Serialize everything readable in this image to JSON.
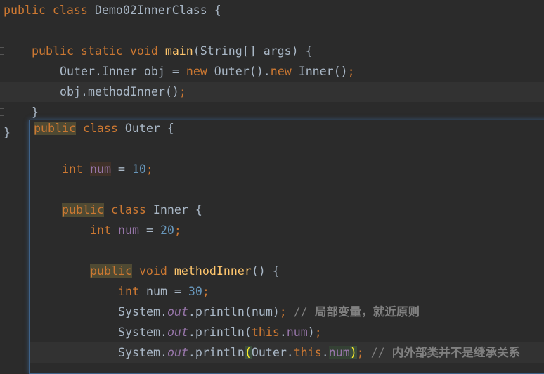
{
  "editor": {
    "current_line": 4,
    "lines": [
      {
        "indent": 0,
        "tokens": [
          [
            "k",
            "public class "
          ],
          [
            "t",
            "Demo02InnerClass {"
          ]
        ]
      },
      {
        "indent": 0,
        "tokens": []
      },
      {
        "indent": 1,
        "tokens": [
          [
            "k",
            "public static void "
          ],
          [
            "m",
            "main"
          ],
          [
            "t",
            "(String[] args) {"
          ]
        ]
      },
      {
        "indent": 2,
        "tokens": [
          [
            "t",
            "Outer.Inner obj = "
          ],
          [
            "k",
            "new "
          ],
          [
            "t",
            "Outer()."
          ],
          [
            "k",
            "new "
          ],
          [
            "t",
            "Inner()"
          ],
          [
            "k",
            ";"
          ]
        ]
      },
      {
        "indent": 2,
        "tokens": [
          [
            "t",
            "obj.methodInner()"
          ],
          [
            "k",
            ";"
          ]
        ]
      },
      {
        "indent": 1,
        "tokens": [
          [
            "t",
            "}"
          ]
        ]
      },
      {
        "indent": 0,
        "tokens": [
          [
            "t",
            "}"
          ]
        ]
      }
    ]
  },
  "popup": {
    "current_line": 11,
    "lines": [
      {
        "indent": 0,
        "tokens": [
          [
            "k hl-usage",
            "public"
          ],
          [
            "k",
            " class "
          ],
          [
            "t",
            "Outer {"
          ]
        ]
      },
      {
        "indent": 0,
        "tokens": []
      },
      {
        "indent": 1,
        "tokens": [
          [
            "k",
            "int "
          ],
          [
            "f hl-var",
            "num"
          ],
          [
            "t",
            " = "
          ],
          [
            "n",
            "10"
          ],
          [
            "k",
            ";"
          ]
        ]
      },
      {
        "indent": 0,
        "tokens": []
      },
      {
        "indent": 1,
        "tokens": [
          [
            "k hl-usage",
            "public"
          ],
          [
            "k",
            " class "
          ],
          [
            "t",
            "Inner {"
          ]
        ]
      },
      {
        "indent": 2,
        "tokens": [
          [
            "k",
            "int "
          ],
          [
            "f",
            "num"
          ],
          [
            "t",
            " = "
          ],
          [
            "n",
            "20"
          ],
          [
            "k",
            ";"
          ]
        ]
      },
      {
        "indent": 0,
        "tokens": []
      },
      {
        "indent": 2,
        "tokens": [
          [
            "k hl-usage",
            "public"
          ],
          [
            "k",
            " void "
          ],
          [
            "m",
            "methodInner"
          ],
          [
            "t",
            "() {"
          ]
        ]
      },
      {
        "indent": 3,
        "tokens": [
          [
            "k",
            "int "
          ],
          [
            "t",
            "num = "
          ],
          [
            "n",
            "30"
          ],
          [
            "k",
            ";"
          ]
        ]
      },
      {
        "indent": 3,
        "tokens": [
          [
            "t",
            "System."
          ],
          [
            "fi",
            "out"
          ],
          [
            "t",
            ".println(num)"
          ],
          [
            "k",
            ";"
          ],
          [
            "c",
            " // "
          ],
          [
            "cb",
            "局部变量，就近原则"
          ]
        ]
      },
      {
        "indent": 3,
        "tokens": [
          [
            "t",
            "System."
          ],
          [
            "fi",
            "out"
          ],
          [
            "t",
            ".println("
          ],
          [
            "k",
            "this"
          ],
          [
            "t",
            "."
          ],
          [
            "f",
            "num"
          ],
          [
            "t",
            ")"
          ],
          [
            "k",
            ";"
          ]
        ]
      },
      {
        "indent": 3,
        "tokens": [
          [
            "t",
            "System."
          ],
          [
            "fi",
            "out"
          ],
          [
            "t",
            ".println"
          ],
          [
            "hl-brace",
            "("
          ],
          [
            "t",
            "Outer."
          ],
          [
            "k",
            "this"
          ],
          [
            "t",
            "."
          ],
          [
            "f hl-field",
            "num"
          ],
          [
            "hl-brace",
            ")"
          ],
          [
            "k",
            ";"
          ],
          [
            "c",
            " // "
          ],
          [
            "cb",
            "内外部类并不是继承关系"
          ]
        ]
      }
    ]
  },
  "colors": {
    "background": "#2b2b2b",
    "keyword": "#cc7832",
    "text": "#a9b7c6",
    "number": "#6897bb",
    "field": "#9876aa",
    "method": "#ffc66d",
    "comment": "#808080"
  }
}
